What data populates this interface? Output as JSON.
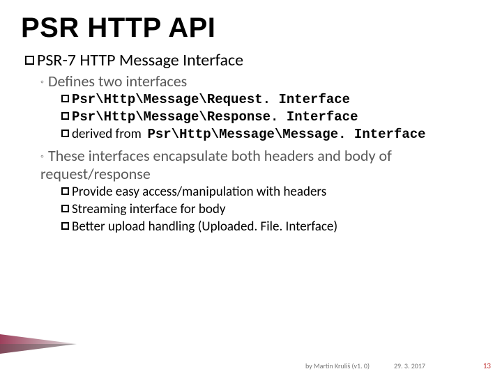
{
  "title": "PSR HTTP API",
  "heading_prefix": "PSR-7",
  "heading_rest": " HTTP Message Interface",
  "defines": "Defines two interfaces",
  "iface_req": "Psr\\Http\\Message\\Request. Interface",
  "iface_res": "Psr\\Http\\Message\\Response. Interface",
  "derived_text": "derived from ",
  "derived_code": "Psr\\Http\\Message\\Message. Interface",
  "encapsulate": "These interfaces encapsulate both headers and body of request/response",
  "point_headers": "Provide easy access/manipulation with headers",
  "point_stream": "Streaming interface for body",
  "point_upload": "Better upload handling (Uploaded. File. Interface)",
  "footer": {
    "by": "by Martin Kruliš (v1. 0)",
    "date": "29. 3. 2017",
    "page": "13"
  }
}
